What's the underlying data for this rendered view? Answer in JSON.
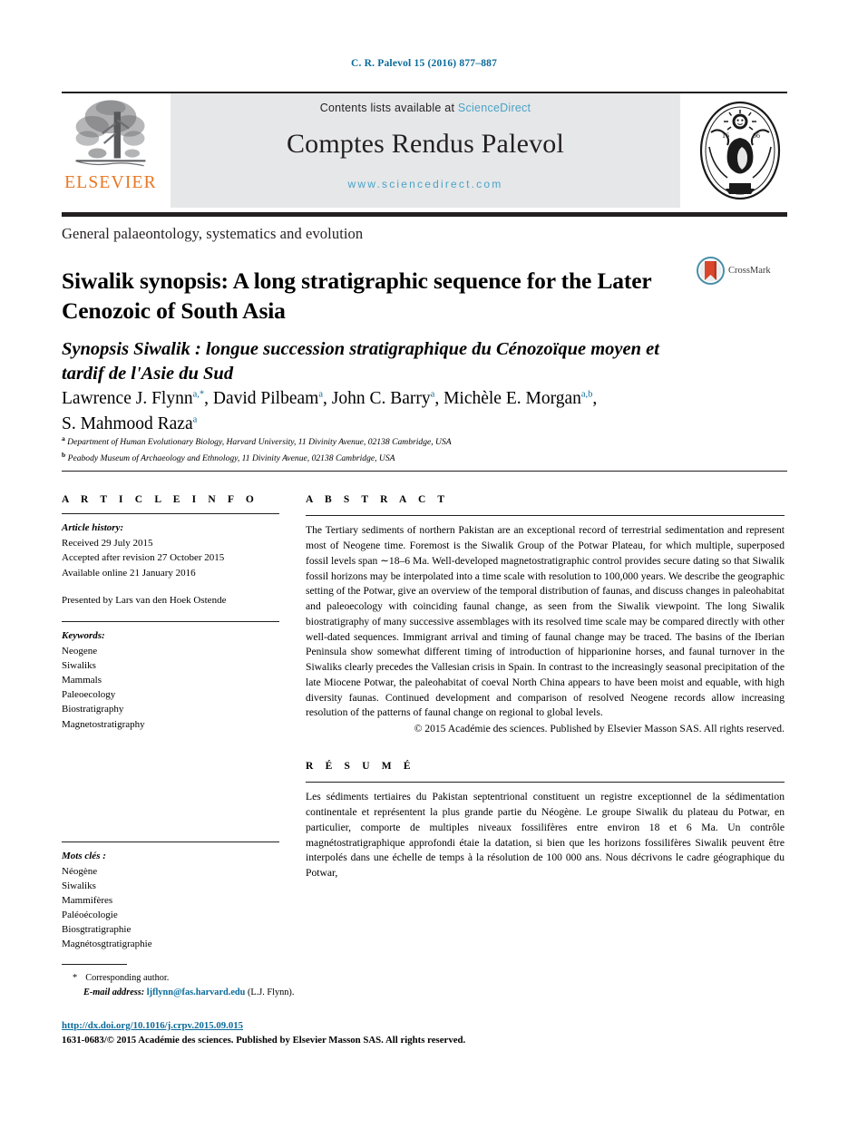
{
  "running_head": "C. R. Palevol 15 (2016) 877–887",
  "masthead": {
    "publisher_name": "ELSEVIER",
    "publisher_logo_icon": "elsevier-tree-icon",
    "contents_prefix": "Contents lists available at ",
    "contents_link": "ScienceDirect",
    "journal_title": "Comptes Rendus Palevol",
    "journal_url": "www.sciencedirect.com",
    "seal_icon": "academie-des-sciences-seal-icon"
  },
  "section_heading": "General palaeontology, systematics and evolution",
  "title": {
    "main": "Siwalik synopsis: A long stratigraphic sequence for the Later Cenozoic of South Asia",
    "french": "Synopsis Siwalik : longue succession stratigraphique du Cénozoïque moyen et tardif de l'Asie du Sud"
  },
  "crossmark": {
    "label": "CrossMark",
    "icon": "crossmark-icon"
  },
  "authors": [
    {
      "name": "Lawrence J. Flynn",
      "marks": "a,*"
    },
    {
      "name": "David Pilbeam",
      "marks": "a"
    },
    {
      "name": "John C. Barry",
      "marks": "a"
    },
    {
      "name": "Michèle E. Morgan",
      "marks": "a,b"
    },
    {
      "name": "S. Mahmood Raza",
      "marks": "a"
    }
  ],
  "affiliations": [
    {
      "mark": "a",
      "text": "Department of Human Evolutionary Biology, Harvard University, 11 Divinity Avenue, 02138 Cambridge, USA"
    },
    {
      "mark": "b",
      "text": "Peabody Museum of Archaeology and Ethnology, 11 Divinity Avenue, 02138 Cambridge, USA"
    }
  ],
  "article_info": {
    "heading": "A R T I C L E   I N F O",
    "history_label": "Article history:",
    "history": [
      "Received 29 July 2015",
      "Accepted after revision 27 October 2015",
      "Available online 21 January 2016"
    ],
    "presented_by": "Presented by Lars van den Hoek Ostende",
    "keywords_label": "Keywords:",
    "keywords": [
      "Neogene",
      "Siwaliks",
      "Mammals",
      "Paleoecology",
      "Biostratigraphy",
      "Magnetostratigraphy"
    ],
    "mots_cles_label": "Mots clés :",
    "mots_cles": [
      "Néogène",
      "Siwaliks",
      "Mammifères",
      "Paléoécologie",
      "Biosgtratigraphie",
      "Magnétosgtratigraphie"
    ]
  },
  "abstract": {
    "heading": "A B S T R A C T",
    "body": "The Tertiary sediments of northern Pakistan are an exceptional record of terrestrial sedimentation and represent most of Neogene time. Foremost is the Siwalik Group of the Potwar Plateau, for which multiple, superposed fossil levels span ∼18–6 Ma. Well-developed magnetostratigraphic control provides secure dating so that Siwalik fossil horizons may be interpolated into a time scale with resolution to 100,000 years. We describe the geographic setting of the Potwar, give an overview of the temporal distribution of faunas, and discuss changes in paleohabitat and paleoecology with coinciding faunal change, as seen from the Siwalik viewpoint. The long Siwalik biostratigraphy of many successive assemblages with its resolved time scale may be compared directly with other well-dated sequences. Immigrant arrival and timing of faunal change may be traced. The basins of the Iberian Peninsula show somewhat different timing of introduction of hipparionine horses, and faunal turnover in the Siwaliks clearly precedes the Vallesian crisis in Spain. In contrast to the increasingly seasonal precipitation of the late Miocene Potwar, the paleohabitat of coeval North China appears to have been moist and equable, with high diversity faunas. Continued development and comparison of resolved Neogene records allow increasing resolution of the patterns of faunal change on regional to global levels.",
    "copyright": "© 2015 Académie des sciences. Published by Elsevier Masson SAS. All rights reserved."
  },
  "resume": {
    "heading": "R É S U M É",
    "body": "Les sédiments tertiaires du Pakistan septentrional constituent un registre exceptionnel de la sédimentation continentale et représentent la plus grande partie du Néogène. Le groupe Siwalik du plateau du Potwar, en particulier, comporte de multiples niveaux fossilifères entre environ 18 et 6 Ma. Un contrôle magnétostratigraphique approfondi étaie la datation, si bien que les horizons fossilifères Siwalik peuvent être interpolés dans une échelle de temps à la résolution de 100 000 ans. Nous décrivons le cadre géographique du Potwar,"
  },
  "footnotes": {
    "corresponding_marker": "*",
    "corresponding_text": "Corresponding author.",
    "email_label": "E-mail address:",
    "email": "ljflynn@fas.harvard.edu",
    "email_attribution": "(L.J. Flynn)."
  },
  "footer": {
    "doi": "http://dx.doi.org/10.1016/j.crpv.2015.09.015",
    "issn_line": "1631-0683/© 2015 Académie des sciences. Published by Elsevier Masson SAS. All rights reserved."
  }
}
